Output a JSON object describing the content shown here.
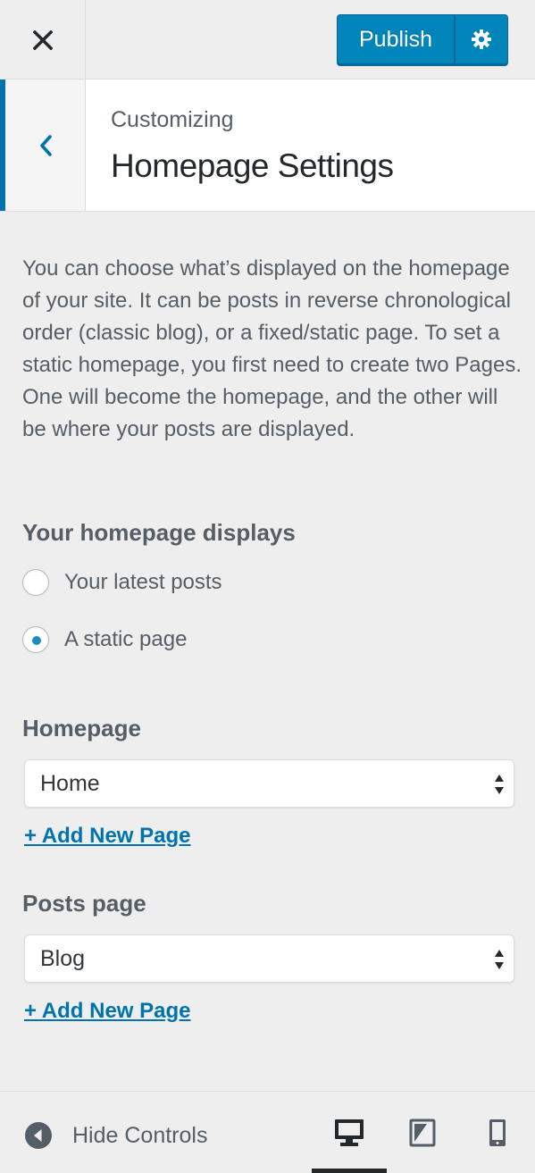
{
  "header": {
    "close_label": "Close",
    "publish_label": "Publish",
    "publish_settings_label": "Publish Settings"
  },
  "section": {
    "back_label": "Back",
    "breadcrumb": "Customizing",
    "title": "Homepage Settings"
  },
  "content": {
    "description": "You can choose what’s displayed on the homepage of your site. It can be posts in reverse chronological order (classic blog), or a fixed/static page. To set a static homepage, you first need to create two Pages. One will become the homepage, and the other will be where your posts are displayed.",
    "displays_heading": "Your homepage displays",
    "radio_options": [
      {
        "label": "Your latest posts",
        "checked": false
      },
      {
        "label": "A static page",
        "checked": true
      }
    ],
    "homepage": {
      "label": "Homepage",
      "selected": "Home",
      "add_link": "+ Add New Page"
    },
    "posts_page": {
      "label": "Posts page",
      "selected": "Blog",
      "add_link": "+ Add New Page"
    }
  },
  "footer": {
    "hide_controls_label": "Hide Controls",
    "devices": [
      {
        "name": "desktop",
        "active": true
      },
      {
        "name": "tablet",
        "active": false
      },
      {
        "name": "mobile",
        "active": false
      }
    ]
  },
  "colors": {
    "accent": "#0073aa",
    "publish": "#0085ba",
    "background": "#eeeeee"
  }
}
